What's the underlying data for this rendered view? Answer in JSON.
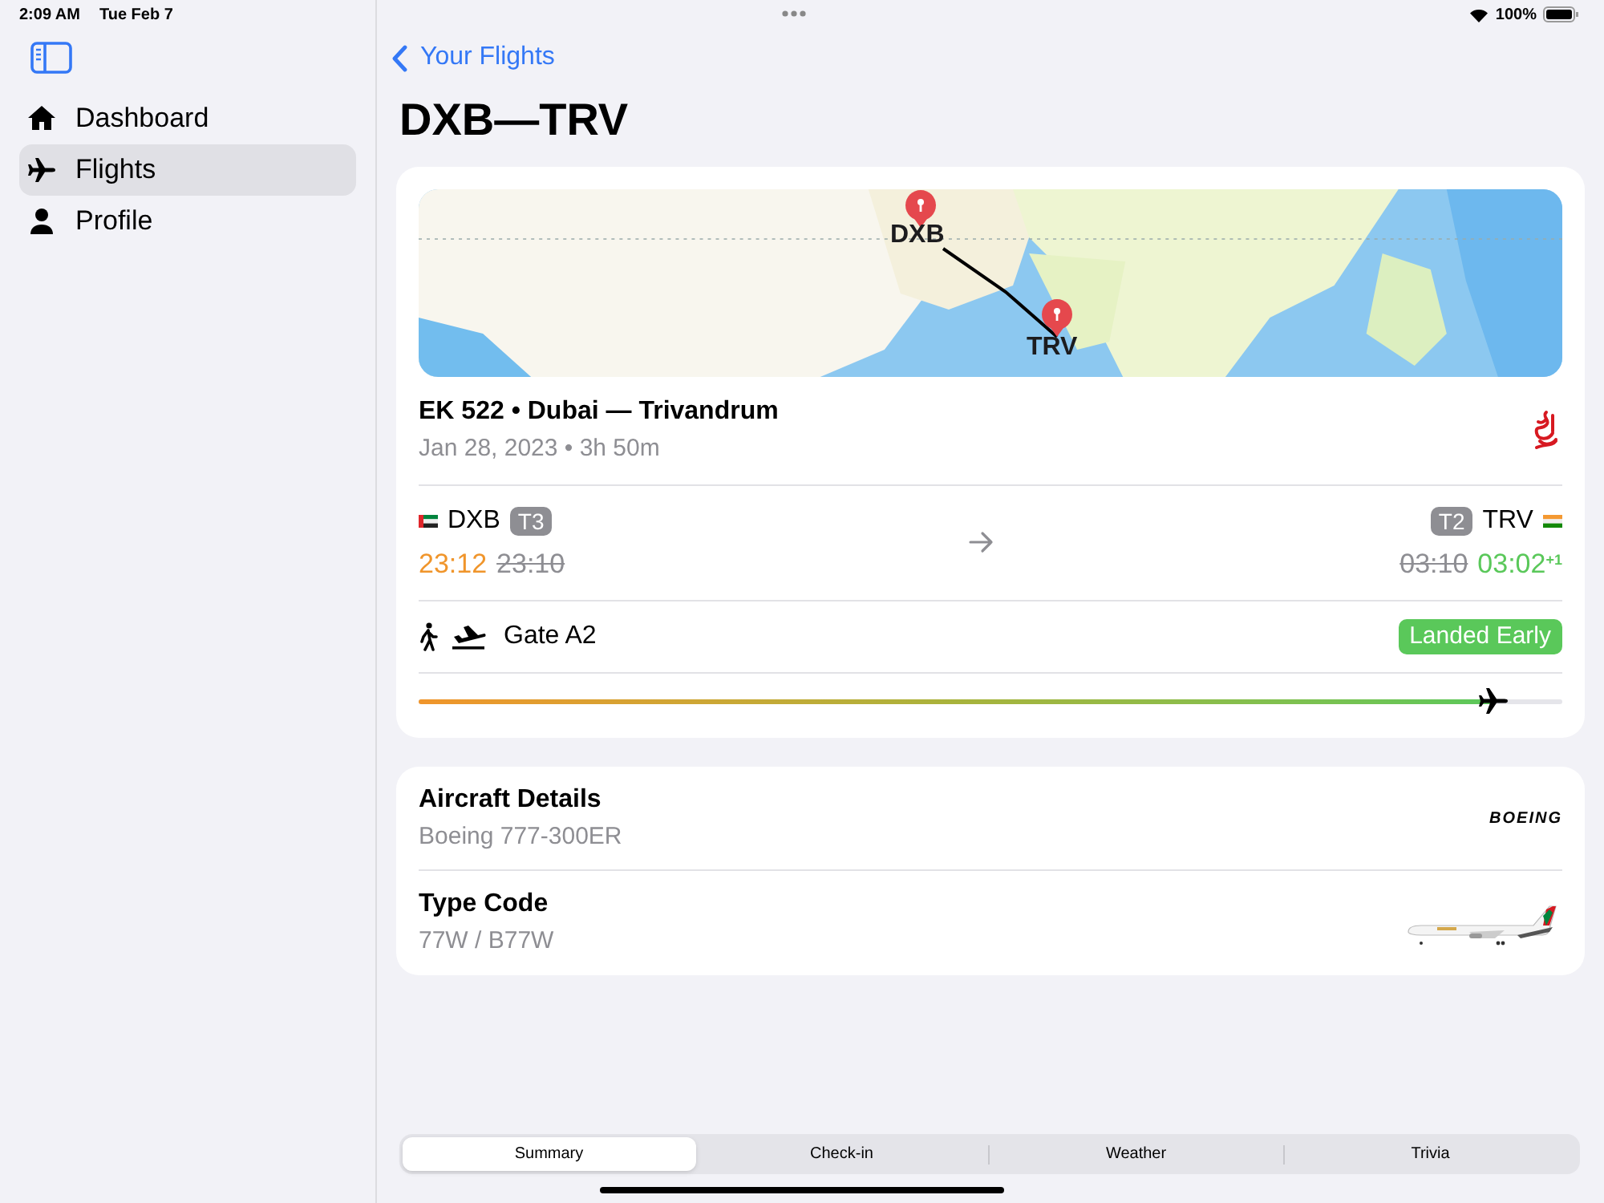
{
  "status_bar": {
    "time": "2:09 AM",
    "date": "Tue Feb 7",
    "battery": "100%"
  },
  "sidebar": {
    "items": [
      {
        "label": "Dashboard",
        "kind": "house",
        "selected": false
      },
      {
        "label": "Flights",
        "kind": "plane",
        "selected": true
      },
      {
        "label": "Profile",
        "kind": "person",
        "selected": false
      }
    ]
  },
  "nav": {
    "back": "Your Flights",
    "title": "DXB—TRV"
  },
  "map": {
    "kind": "picture",
    "markers": [
      {
        "label": "DXB"
      },
      {
        "label": "TRV"
      }
    ]
  },
  "flight": {
    "title": "EK 522 • Dubai — Trivandrum",
    "subtitle": "Jan 28, 2023 • 3h 50m",
    "departure": {
      "code": "DXB",
      "terminal": "T3",
      "actual": "23:12",
      "scheduled": "23:10"
    },
    "arrival": {
      "code": "TRV",
      "terminal": "T2",
      "actual": "03:02",
      "day_offset": "+1",
      "scheduled": "03:10"
    },
    "gate": "Gate A2",
    "status": "Landed Early",
    "progress": {
      "level": 0.94
    }
  },
  "aircraft": [
    {
      "kind": "maker",
      "label": "Aircraft Details",
      "value": "Boeing 777-300ER",
      "logo": "BOEING"
    },
    {
      "kind": "plane",
      "label": "Type Code",
      "value": "77W / B77W"
    }
  ],
  "tabs": [
    {
      "label": "Summary",
      "selected": true
    },
    {
      "label": "Check-in",
      "selected": false
    },
    {
      "label": "Weather",
      "selected": false
    },
    {
      "label": "Trivia",
      "selected": false
    }
  ]
}
